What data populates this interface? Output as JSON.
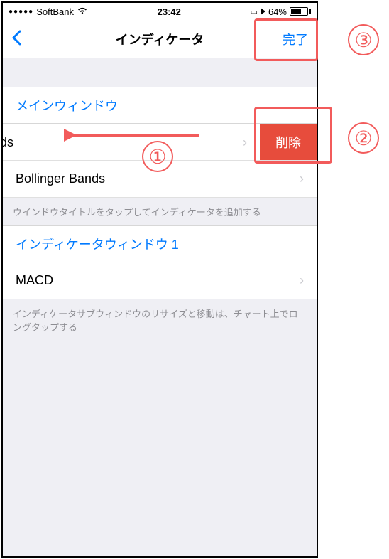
{
  "status": {
    "carrier": "SoftBank",
    "time": "23:42",
    "battery_pct": "64%"
  },
  "nav": {
    "title": "インディケータ",
    "done": "完了"
  },
  "sections": {
    "main": {
      "header": "メインウィンドウ",
      "items": [
        {
          "label": "ger Bands"
        },
        {
          "label": "Bollinger Bands"
        }
      ],
      "delete_label": "削除",
      "hint": "ウインドウタイトルをタップしてインディケータを追加する"
    },
    "indicator": {
      "header": "インディケータウィンドウ 1",
      "items": [
        {
          "label": "MACD"
        }
      ],
      "hint": "インディケータサブウィンドウのリサイズと移動は、チャート上でロングタップする"
    }
  },
  "annotations": {
    "n1": "①",
    "n2": "②",
    "n3": "③"
  }
}
